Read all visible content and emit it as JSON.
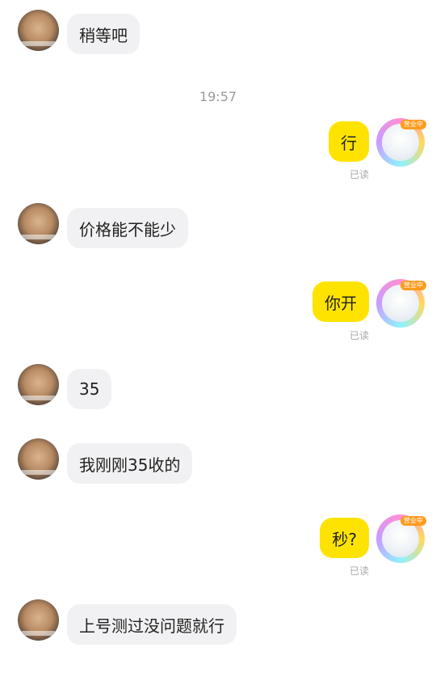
{
  "messages": [
    {
      "text": "稍等吧"
    },
    {
      "time": "19:57"
    },
    {
      "text": "行",
      "status": "已读"
    },
    {
      "text": "价格能不能少"
    },
    {
      "text": "你开",
      "status": "已读"
    },
    {
      "text": "35"
    },
    {
      "text": "我刚刚35收的"
    },
    {
      "text": "秒?",
      "status": "已读"
    },
    {
      "text": "上号测过没问题就行"
    }
  ],
  "avatar_badge": "营业中"
}
